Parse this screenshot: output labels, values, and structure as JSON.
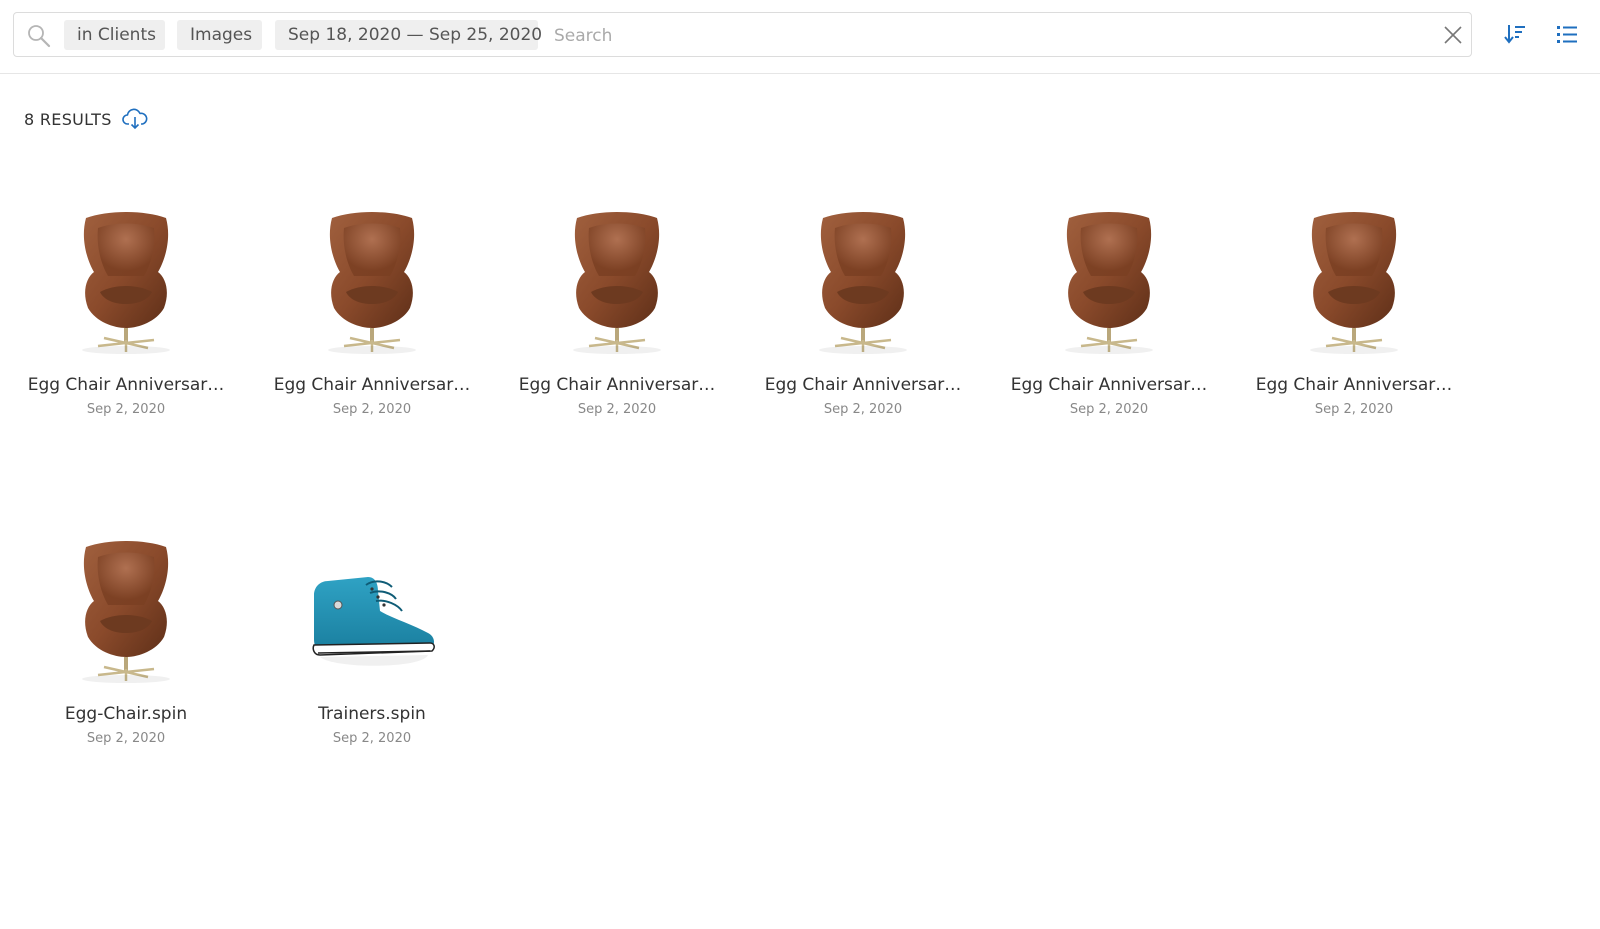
{
  "search": {
    "filters": [
      "in Clients",
      "Images",
      "Sep 18, 2020 — Sep 25, 2020"
    ],
    "placeholder": "Search",
    "value": ""
  },
  "toolbar": {
    "icons": [
      "search-icon",
      "close-icon",
      "sort-icon",
      "list-view-icon"
    ],
    "accent_color": "#1f6fbf"
  },
  "results": {
    "count_label": "8 RESULTS",
    "download_icon": "cloud-download-icon"
  },
  "items": [
    {
      "name": "Egg Chair Anniversar…",
      "date": "Sep 2, 2020",
      "thumbnail": "egg-chair"
    },
    {
      "name": "Egg Chair Anniversar…",
      "date": "Sep 2, 2020",
      "thumbnail": "egg-chair"
    },
    {
      "name": "Egg Chair Anniversar…",
      "date": "Sep 2, 2020",
      "thumbnail": "egg-chair"
    },
    {
      "name": "Egg Chair Anniversar…",
      "date": "Sep 2, 2020",
      "thumbnail": "egg-chair"
    },
    {
      "name": "Egg Chair Anniversar…",
      "date": "Sep 2, 2020",
      "thumbnail": "egg-chair"
    },
    {
      "name": "Egg Chair Anniversar…",
      "date": "Sep 2, 2020",
      "thumbnail": "egg-chair"
    },
    {
      "name": "Egg-Chair.spin",
      "date": "Sep 2, 2020",
      "thumbnail": "egg-chair"
    },
    {
      "name": "Trainers.spin",
      "date": "Sep 2, 2020",
      "thumbnail": "trainer-shoe"
    }
  ]
}
